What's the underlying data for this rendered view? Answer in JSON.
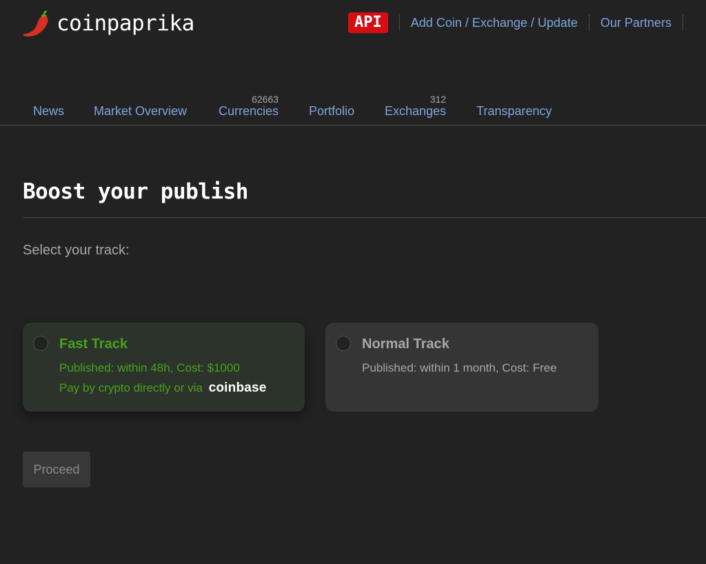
{
  "header": {
    "logo_text": "coinpaprika",
    "logo_icon": "chili-pepper-icon",
    "api_label": "API",
    "links": [
      {
        "label": "Add Coin / Exchange / Update"
      },
      {
        "label": "Our Partners"
      }
    ]
  },
  "nav": {
    "items": [
      {
        "label": "News",
        "count": null
      },
      {
        "label": "Market Overview",
        "count": null
      },
      {
        "label": "Currencies",
        "count": "62663"
      },
      {
        "label": "Portfolio",
        "count": null
      },
      {
        "label": "Exchanges",
        "count": "312"
      },
      {
        "label": "Transparency",
        "count": null
      }
    ]
  },
  "main": {
    "title": "Boost your publish",
    "select_label": "Select your track:",
    "tracks": [
      {
        "title": "Fast Track",
        "line1": "Published: within 48h, Cost: $1000",
        "line2": "Pay by crypto directly or via",
        "payment_brand": "coinbase",
        "selected": false,
        "accent": "#4aa21d"
      },
      {
        "title": "Normal Track",
        "line1": "Published: within 1 month, Cost: Free",
        "selected": false
      }
    ],
    "proceed_label": "Proceed"
  },
  "colors": {
    "background": "#222222",
    "link": "#7fa4de",
    "api_badge": "#d40f14",
    "fast_track_green": "#4aa21d"
  }
}
